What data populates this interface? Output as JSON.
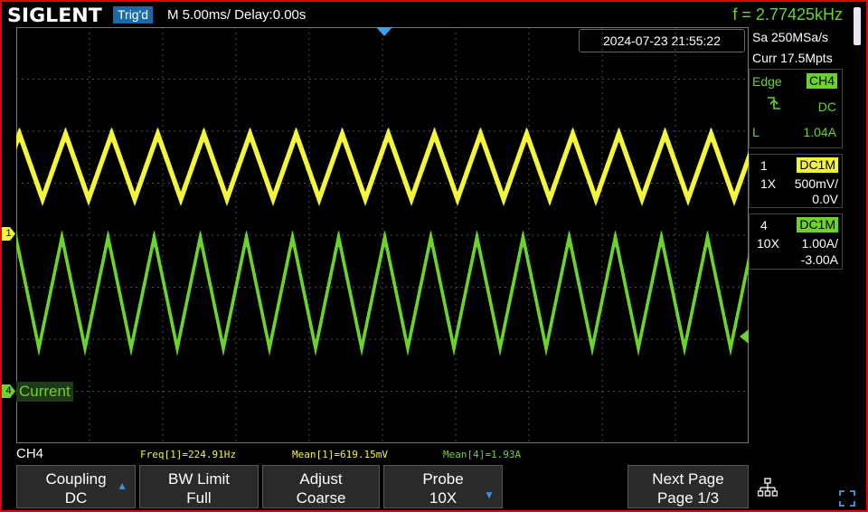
{
  "brand": "SIGLENT",
  "trigger_status": "Trig'd",
  "timebase": "M 5.00ms/ Delay:0.00s",
  "frequency": "f = 2.77425kHz",
  "datetime": "2024-07-23 21:55:22",
  "sample_rate": "Sa 250MSa/s",
  "memory": "Curr 17.5Mpts",
  "trigger_panel": {
    "type": "Edge",
    "source": "CH4",
    "coupling": "DC",
    "level_prefix": "L",
    "level": "1.04A"
  },
  "channels": [
    {
      "number": "1",
      "coupling": "DC1M",
      "probe": "1X",
      "scale": "500mV/",
      "offset": "0.0V",
      "color": "#f5f53c"
    },
    {
      "number": "4",
      "coupling": "DC1M",
      "probe": "10X",
      "scale": "1.00A/",
      "offset": "-3.00A",
      "color": "#6bd32c"
    }
  ],
  "markers": {
    "ch1": "1",
    "ch4": "4",
    "ch4_label": "Current"
  },
  "waveforms": [
    {
      "channel": "1",
      "color": "#f5f53c",
      "shape": "triangle"
    },
    {
      "channel": "4",
      "color": "#6bd32c",
      "shape": "triangle"
    }
  ],
  "status": {
    "active_channel": "CH4",
    "measurements": [
      {
        "text": "Freq[1]=224.91Hz",
        "color": "#f5f53c"
      },
      {
        "text": "Mean[1]=619.15mV",
        "color": "#f5f53c"
      },
      {
        "text": "Mean[4]=1.93A",
        "color": "#6bd32c"
      }
    ]
  },
  "softkeys": [
    {
      "title": "Coupling",
      "value": "DC",
      "arrow": "up"
    },
    {
      "title": "BW Limit",
      "value": "Full",
      "arrow": ""
    },
    {
      "title": "Adjust",
      "value": "Coarse",
      "arrow": ""
    },
    {
      "title": "Probe",
      "value": "10X",
      "arrow": "down"
    },
    {
      "title": "Next Page",
      "value": "Page 1/3",
      "arrow": ""
    }
  ],
  "icons": {
    "network": "network-icon",
    "fullscreen": "fullscreen-icon",
    "scroll": "scroll-handle-icon"
  },
  "colors": {
    "ch1": "#f5f53c",
    "ch4": "#6bd32c",
    "trig_badge": "#1a6aa8",
    "trigger_marker": "#3f9ee8",
    "grid": "#555555"
  }
}
